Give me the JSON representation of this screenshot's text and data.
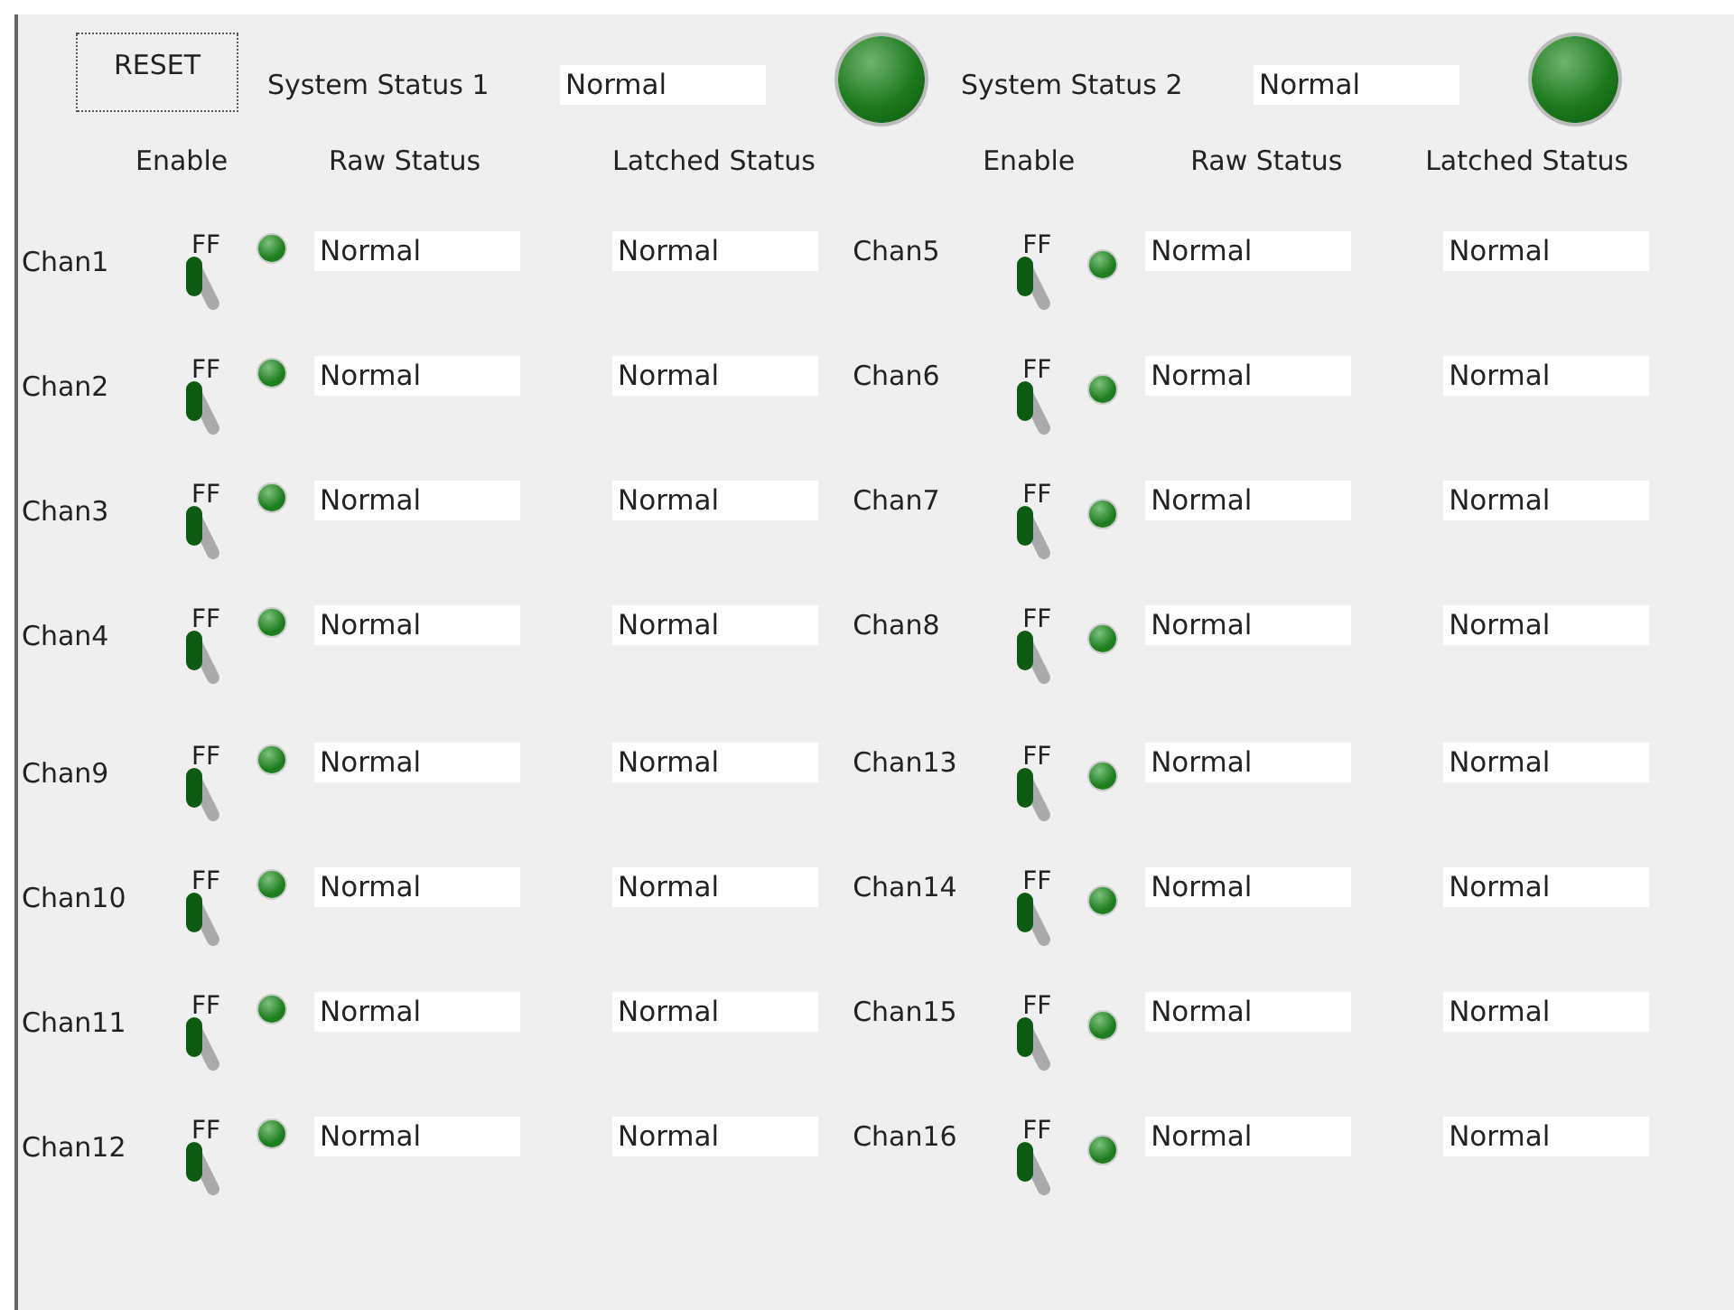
{
  "reset_button": "RESET",
  "systems": [
    {
      "label": "System Status 1",
      "value": "Normal",
      "ok": true
    },
    {
      "label": "System Status 2",
      "value": "Normal",
      "ok": true
    }
  ],
  "panels": [
    {
      "headers": [
        "Enable",
        "Raw Status",
        "Latched Status"
      ],
      "channels": [
        {
          "name": "Chan1",
          "switch_label": "FF",
          "on": false,
          "ok": true,
          "raw": "Normal",
          "latched": "Normal"
        },
        {
          "name": "Chan2",
          "switch_label": "FF",
          "on": false,
          "ok": true,
          "raw": "Normal",
          "latched": "Normal"
        },
        {
          "name": "Chan3",
          "switch_label": "FF",
          "on": false,
          "ok": true,
          "raw": "Normal",
          "latched": "Normal"
        },
        {
          "name": "Chan4",
          "switch_label": "FF",
          "on": false,
          "ok": true,
          "raw": "Normal",
          "latched": "Normal"
        },
        {
          "name": "Chan9",
          "switch_label": "FF",
          "on": false,
          "ok": true,
          "raw": "Normal",
          "latched": "Normal"
        },
        {
          "name": "Chan10",
          "switch_label": "FF",
          "on": false,
          "ok": true,
          "raw": "Normal",
          "latched": "Normal"
        },
        {
          "name": "Chan11",
          "switch_label": "FF",
          "on": false,
          "ok": true,
          "raw": "Normal",
          "latched": "Normal"
        },
        {
          "name": "Chan12",
          "switch_label": "FF",
          "on": false,
          "ok": true,
          "raw": "Normal",
          "latched": "Normal"
        }
      ]
    },
    {
      "headers": [
        "Enable",
        "Raw Status",
        "Latched Status"
      ],
      "channels": [
        {
          "name": "Chan5",
          "switch_label": "FF",
          "on": false,
          "ok": true,
          "raw": "Normal",
          "latched": "Normal"
        },
        {
          "name": "Chan6",
          "switch_label": "FF",
          "on": false,
          "ok": true,
          "raw": "Normal",
          "latched": "Normal"
        },
        {
          "name": "Chan7",
          "switch_label": "FF",
          "on": false,
          "ok": true,
          "raw": "Normal",
          "latched": "Normal"
        },
        {
          "name": "Chan8",
          "switch_label": "FF",
          "on": false,
          "ok": true,
          "raw": "Normal",
          "latched": "Normal"
        },
        {
          "name": "Chan13",
          "switch_label": "FF",
          "on": false,
          "ok": true,
          "raw": "Normal",
          "latched": "Normal"
        },
        {
          "name": "Chan14",
          "switch_label": "FF",
          "on": false,
          "ok": true,
          "raw": "Normal",
          "latched": "Normal"
        },
        {
          "name": "Chan15",
          "switch_label": "FF",
          "on": false,
          "ok": true,
          "raw": "Normal",
          "latched": "Normal"
        },
        {
          "name": "Chan16",
          "switch_label": "FF",
          "on": false,
          "ok": true,
          "raw": "Normal",
          "latched": "Normal"
        }
      ]
    }
  ]
}
